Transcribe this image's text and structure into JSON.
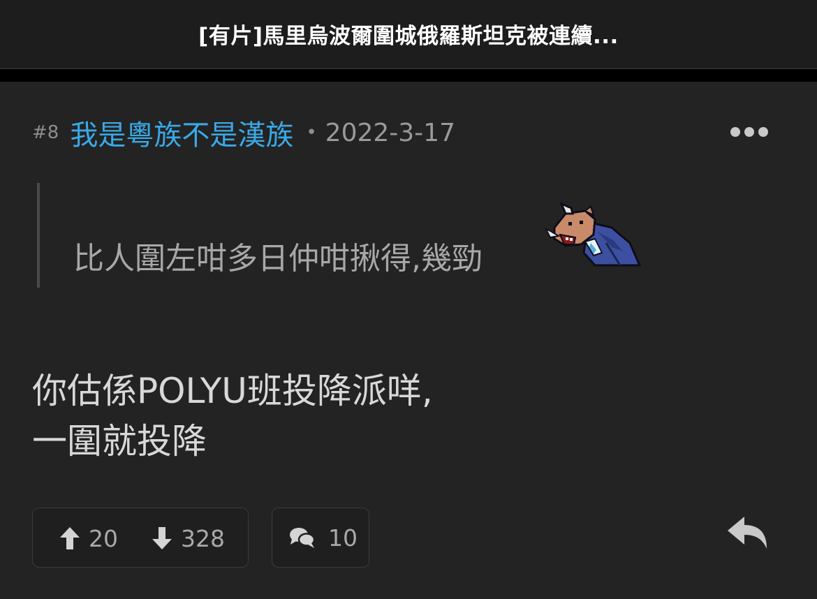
{
  "header": {
    "title": "[有片]馬里烏波爾圍城俄羅斯坦克被連續..."
  },
  "post": {
    "number": "#8",
    "author": "我是粵族不是漢族",
    "separator": "•",
    "date": "2022-3-17",
    "quote": "比人圍左咁多日仲咁揪得,幾勁",
    "body_line_1": "你估係POLYU班投降派咩,",
    "body_line_2": "一圍就投降"
  },
  "actions": {
    "upvotes": "20",
    "downvotes": "328",
    "replies": "10"
  },
  "icons": {
    "more": "more-options-icon",
    "upvote": "arrow-up-icon",
    "downvote": "arrow-down-icon",
    "reply": "comment-bubbles-icon",
    "share": "reply-arrow-icon",
    "emoji": "pig-in-suit-sticker"
  },
  "colors": {
    "username": "#3aa9e6",
    "background": "#232323",
    "header": "#1d1d1d"
  }
}
